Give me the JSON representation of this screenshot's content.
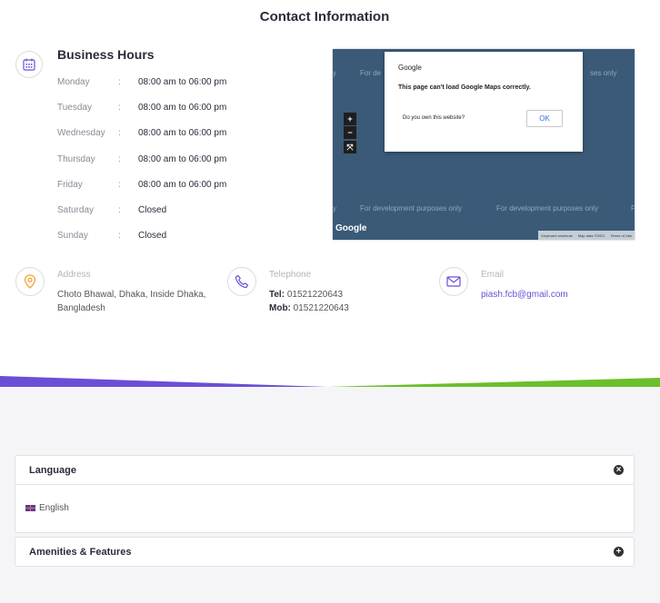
{
  "section": {
    "title": "Contact Information"
  },
  "business_hours": {
    "title": "Business Hours",
    "separator": ":",
    "days": [
      {
        "day": "Monday",
        "hours": "08:00 am to 06:00 pm"
      },
      {
        "day": "Tuesday",
        "hours": "08:00 am to 06:00 pm"
      },
      {
        "day": "Wednesday",
        "hours": "08:00 am to 06:00 pm"
      },
      {
        "day": "Thursday",
        "hours": "08:00 am to 06:00 pm"
      },
      {
        "day": "Friday",
        "hours": "08:00 am to 06:00 pm"
      },
      {
        "day": "Saturday",
        "hours": "Closed"
      },
      {
        "day": "Sunday",
        "hours": "Closed"
      }
    ]
  },
  "map": {
    "watermark": "For development purposes only",
    "watermark_short_left": "For de",
    "watermark_short_right": "ses only",
    "zoom_in": "+",
    "zoom_out": "−",
    "fullscreen": "⤧",
    "logo": "Google",
    "footer": {
      "shortcuts": "Keyboard shortcuts",
      "map_data": "Map data ©2021",
      "terms": "Terms of Use"
    },
    "dialog": {
      "title": "Google",
      "message": "This page can't load Google Maps correctly.",
      "question": "Do you own this website?",
      "ok_label": "OK"
    }
  },
  "contact": {
    "address": {
      "label": "Address",
      "line1": "Choto Bhawal, Dhaka, Inside Dhaka,",
      "line2": "Bangladesh"
    },
    "telephone": {
      "label": "Telephone",
      "tel_label": "Tel:",
      "tel": " 01521220643",
      "mob_label": "Mob:",
      "mob": " 01521220643"
    },
    "email": {
      "label": "Email",
      "value": "piash.fcb@gmail.com"
    }
  },
  "accordion": {
    "language": {
      "title": "Language",
      "toggle": "×",
      "item": "English"
    },
    "amenities": {
      "title": "Amenities & Features",
      "toggle": "+"
    }
  },
  "colors": {
    "accent_purple": "#6c4ed6",
    "accent_green": "#6abf2a",
    "address_orange": "#f2a532",
    "map_bg": "#3a5a78"
  }
}
